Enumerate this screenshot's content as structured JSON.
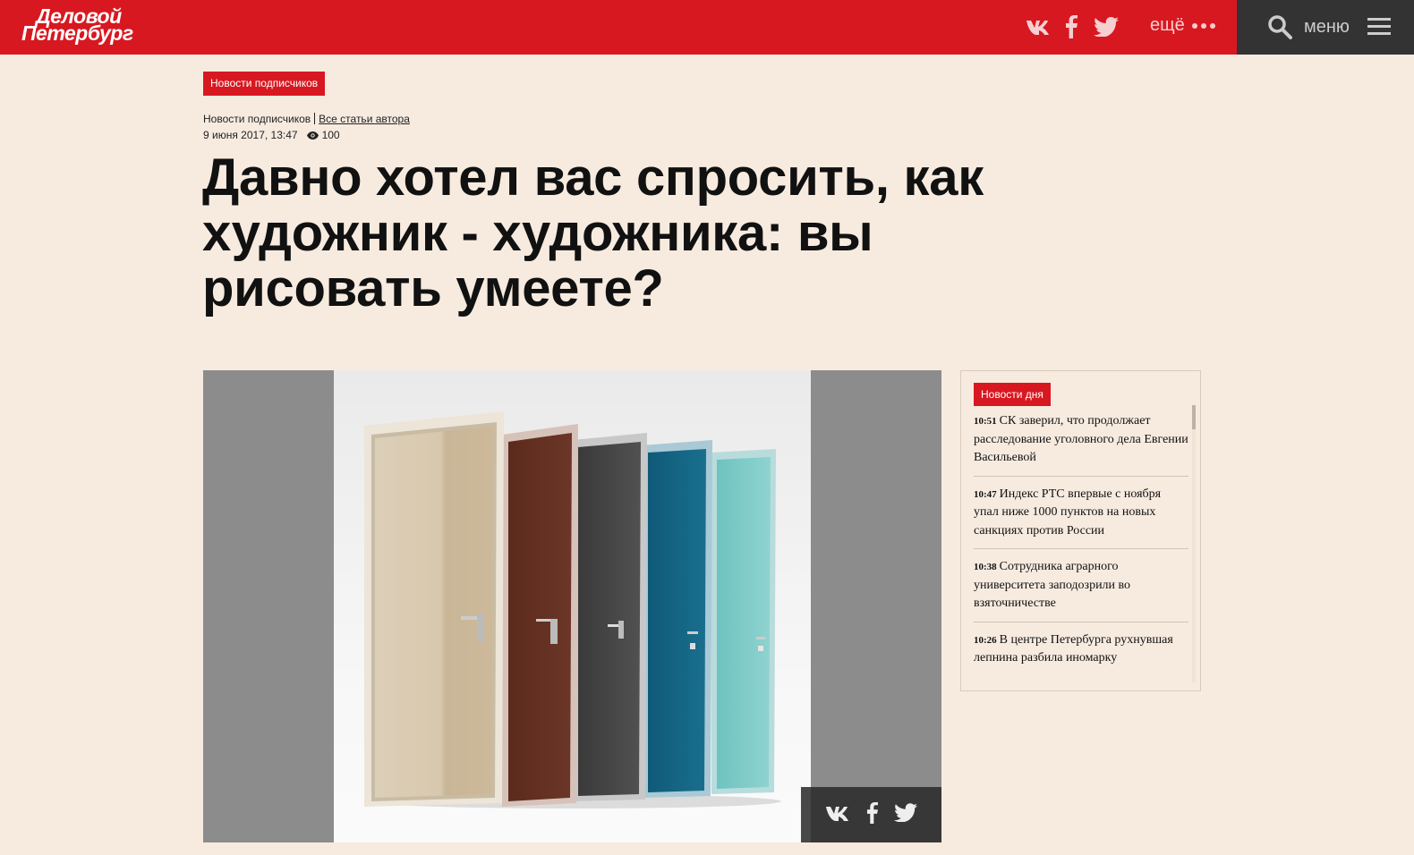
{
  "header": {
    "logo_line1": "Деловой",
    "logo_line2": "Петербург",
    "more_label": "ещё",
    "menu_label": "меню",
    "social_icons": [
      "vk-icon",
      "facebook-icon",
      "twitter-icon"
    ]
  },
  "article": {
    "category_badge": "Новости подписчиков",
    "section": "Новости подписчиков",
    "author_link": "Все статьи автора",
    "date": "9 июня 2017, 13:47",
    "views": "100",
    "title": "Давно хотел вас спросить, как художник -  художника: вы рисовать умеете?",
    "image_alt": "doors-photo"
  },
  "sidebar": {
    "badge": "Новости дня",
    "items": [
      {
        "time": "10:51",
        "text": "СК заверил, что продолжает расследование уголовного дела Евгении Васильевой"
      },
      {
        "time": "10:47",
        "text": "Индекс РТС впервые с ноября упал ниже 1000 пунктов на новых санкциях против России"
      },
      {
        "time": "10:38",
        "text": "Сотрудника аграрного университета заподозрили во взяточничестве"
      },
      {
        "time": "10:26",
        "text": "В центре Петербурга рухнувшая лепнина разбила иномарку"
      }
    ]
  },
  "colors": {
    "brand_red": "#d81820",
    "page_bg": "#f7ebe0",
    "dark_bar": "#333333"
  }
}
